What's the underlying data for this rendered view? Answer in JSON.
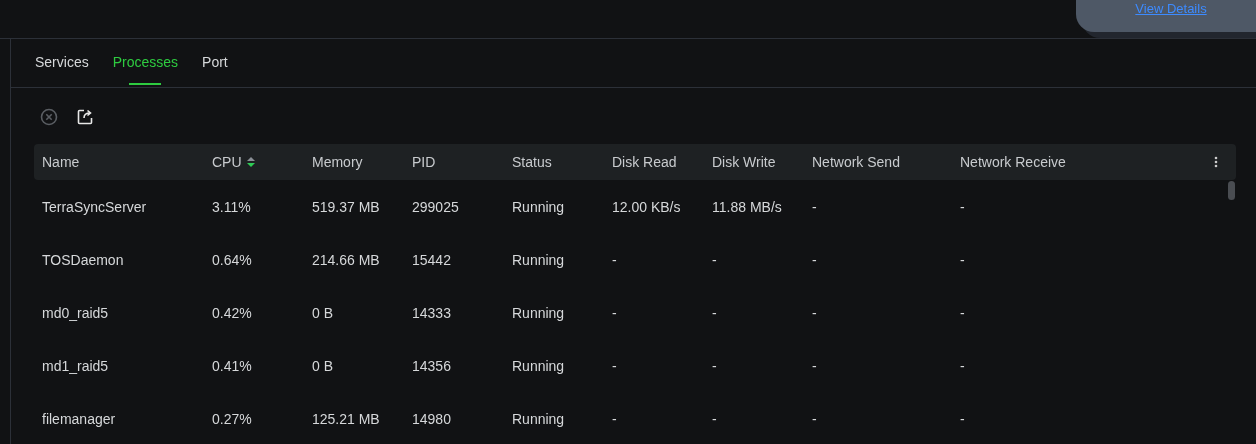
{
  "notice": {
    "link": "View Details"
  },
  "tabs": [
    {
      "label": "Services",
      "selected": false
    },
    {
      "label": "Processes",
      "selected": true
    },
    {
      "label": "Port",
      "selected": false
    }
  ],
  "toolbar": {
    "end_process_disabled": true
  },
  "table": {
    "sort_descending": true,
    "columns": [
      {
        "label": "Name",
        "sorted": false
      },
      {
        "label": "CPU",
        "sorted": true
      },
      {
        "label": "Memory",
        "sorted": false
      },
      {
        "label": "PID",
        "sorted": false
      },
      {
        "label": "Status",
        "sorted": false
      },
      {
        "label": "Disk Read",
        "sorted": false
      },
      {
        "label": "Disk Write",
        "sorted": false
      },
      {
        "label": "Network Send",
        "sorted": false
      },
      {
        "label": "Network Receive",
        "sorted": false
      }
    ],
    "rows": [
      [
        "TerraSyncServer",
        "3.11%",
        "519.37 MB",
        "299025",
        "Running",
        "12.00 KB/s",
        "11.88 MB/s",
        "-",
        "-"
      ],
      [
        "TOSDaemon",
        "0.64%",
        "214.66 MB",
        "15442",
        "Running",
        "-",
        "-",
        "-",
        "-"
      ],
      [
        "md0_raid5",
        "0.42%",
        "0 B",
        "14333",
        "Running",
        "-",
        "-",
        "-",
        "-"
      ],
      [
        "md1_raid5",
        "0.41%",
        "0 B",
        "14356",
        "Running",
        "-",
        "-",
        "-",
        "-"
      ],
      [
        "filemanager",
        "0.27%",
        "125.21 MB",
        "14980",
        "Running",
        "-",
        "-",
        "-",
        "-"
      ]
    ]
  }
}
